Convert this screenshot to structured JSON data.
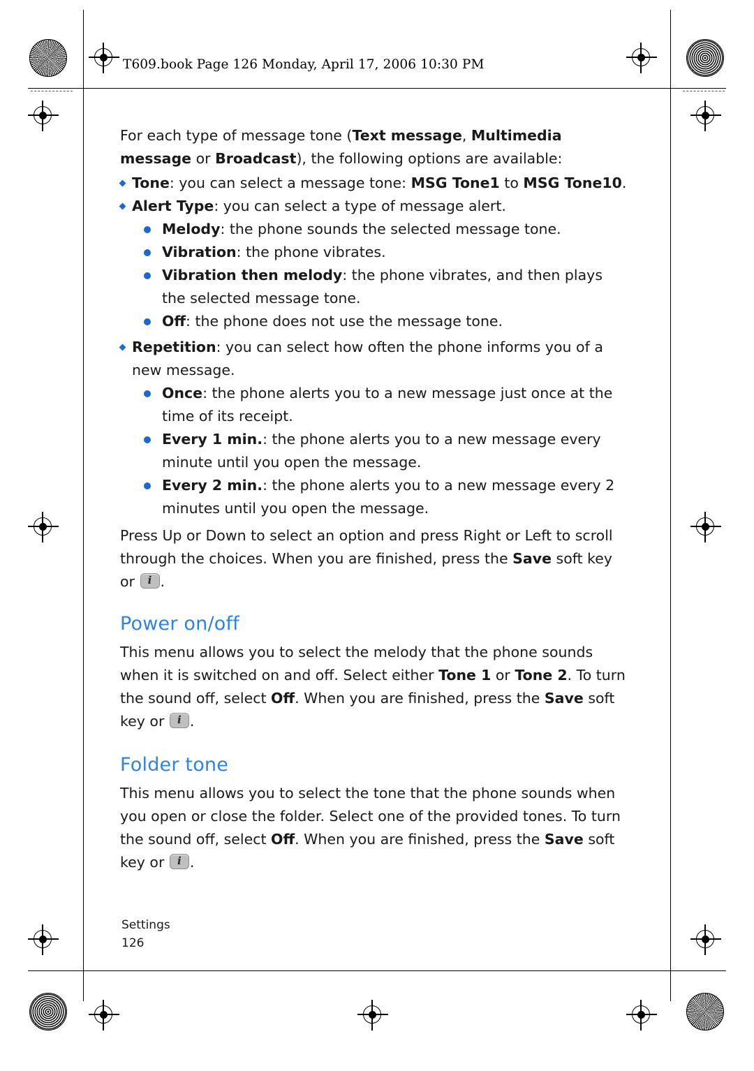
{
  "header": {
    "book_line": "T609.book  Page 126  Monday, April 17, 2006  10:30 PM"
  },
  "content": {
    "intro": {
      "part1": "For each type of message tone (",
      "bold1": "Text message",
      "part2": ", ",
      "bold2": "Multimedia message",
      "part3": " or ",
      "bold3": "Broadcast",
      "part4": "), the following options are available:"
    },
    "bullets": [
      {
        "bold": "Tone",
        "text_before": ": you can select a message tone: ",
        "bold_mid": "MSG Tone1",
        "text_mid": " to ",
        "bold_end": "MSG Tone10",
        "text_after": "."
      },
      {
        "bold": "Alert Type",
        "text": ": you can select a type of message alert."
      },
      {
        "bold": "Repetition",
        "text": ": you can select how often the phone informs you of a new message."
      }
    ],
    "alert_type_options": [
      {
        "bold": "Melody",
        "text": ": the phone sounds the selected message tone."
      },
      {
        "bold": "Vibration",
        "text": ": the phone vibrates."
      },
      {
        "bold": "Vibration then melody",
        "text": ": the phone vibrates, and then plays the selected message tone."
      },
      {
        "bold": "Off",
        "text": ": the phone does not use the message tone."
      }
    ],
    "repetition_options": [
      {
        "bold": "Once",
        "text": ": the phone alerts you to a new message just once at the time of its receipt."
      },
      {
        "bold": "Every 1 min.",
        "text": ": the phone alerts you to a new message every minute until you open the message."
      },
      {
        "bold": "Every 2 min.",
        "text": ": the phone alerts you to a new message every 2 minutes until you open the message."
      }
    ],
    "press_para": {
      "part1": "Press Up or Down to select an option and press Right or Left to scroll through the choices. When you are finished, press the ",
      "bold1": "Save",
      "part2": " soft key or ",
      "part3": "."
    },
    "sections": [
      {
        "title": "Power on/off",
        "paragraph": {
          "part1": "This menu allows you to select the melody that the phone sounds when it is switched on and off. Select either ",
          "bold1": "Tone 1",
          "part2": " or ",
          "bold2": "Tone 2",
          "part3": ". To turn the sound off, select ",
          "bold3": "Off",
          "part4": ". When you are finished, press the ",
          "bold4": "Save",
          "part5": " soft key or ",
          "part6": "."
        }
      },
      {
        "title": "Folder tone",
        "paragraph": {
          "part1": "This menu allows you to select the tone that the phone sounds when you open or close the folder. Select one of the provided tones. To turn the sound off, select ",
          "bold1": "Off",
          "part2": ". When you are finished, press the ",
          "bold2": "Save",
          "part3": " soft key or ",
          "part4": "."
        }
      }
    ]
  },
  "footer": {
    "chapter": "Settings",
    "page_number": "126"
  },
  "colors": {
    "heading": "#2f83e8",
    "bullet": "#1868d6",
    "text": "#1a1a1a"
  }
}
